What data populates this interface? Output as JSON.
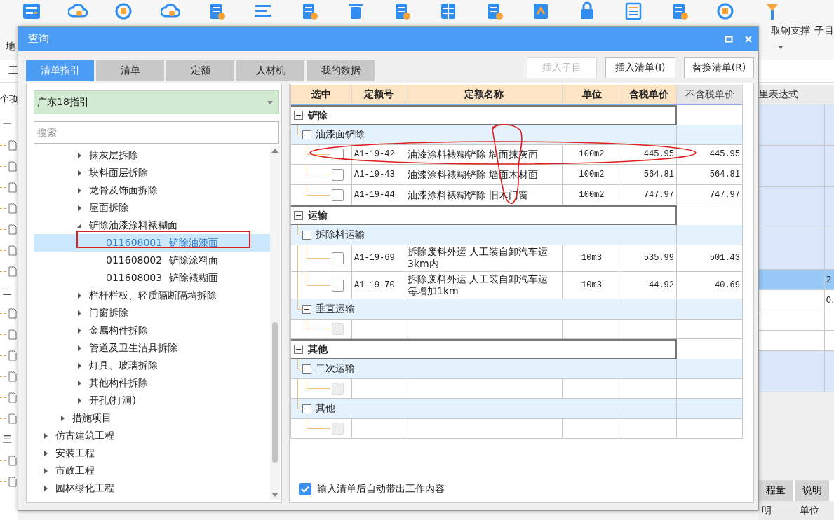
{
  "app": {
    "toolbar": {
      "left_label": "地",
      "right_labels": [
        "取钢支撑",
        "子目"
      ]
    },
    "ribbon_label": "工",
    "left_panel": {
      "header": "个项",
      "items": [
        {
          "kind": "node",
          "label": "一"
        },
        {
          "kind": "doc"
        },
        {
          "kind": "doc"
        },
        {
          "kind": "doc"
        },
        {
          "kind": "doc"
        },
        {
          "kind": "doc"
        },
        {
          "kind": "doc"
        },
        {
          "kind": "doc"
        },
        {
          "kind": "node",
          "label": "二"
        },
        {
          "kind": "doc"
        },
        {
          "kind": "doc"
        },
        {
          "kind": "doc"
        },
        {
          "kind": "doc"
        },
        {
          "kind": "doc"
        },
        {
          "kind": "doc"
        },
        {
          "kind": "node",
          "label": "三"
        },
        {
          "kind": "doc"
        },
        {
          "kind": "doc"
        }
      ]
    },
    "right_panel": {
      "header": "里表达式",
      "rows": [
        {
          "kind": "blue"
        },
        {
          "kind": "blue"
        },
        {
          "kind": "blue"
        },
        {
          "kind": "blue"
        },
        {
          "kind": "blue",
          "value": "2",
          "selected": true
        },
        {
          "kind": "white",
          "value": "0."
        },
        {
          "kind": "white"
        },
        {
          "kind": "white"
        },
        {
          "kind": "blue"
        }
      ],
      "tabs": [
        {
          "label": "程量",
          "selected": false
        },
        {
          "label": "说明",
          "selected": false
        }
      ],
      "columns": [
        "明",
        "单位"
      ]
    }
  },
  "dialog": {
    "title": "查询",
    "tabs": [
      {
        "label": "清单指引",
        "selected": true
      },
      {
        "label": "清单",
        "selected": false
      },
      {
        "label": "定额",
        "selected": false
      },
      {
        "label": "人材机",
        "selected": false
      },
      {
        "label": "我的数据",
        "selected": false
      }
    ],
    "buttons": [
      {
        "label": "插入子目",
        "disabled": true
      },
      {
        "label": "插入清单(I)",
        "disabled": false
      },
      {
        "label": "替换清单(R)",
        "disabled": false
      }
    ],
    "library": "广东18指引",
    "search": {
      "placeholder": "搜索"
    },
    "tree": [
      {
        "children": [
          {
            "children": [
              {
                "label": "抹灰层拆除",
                "expanded": false,
                "selected": false
              },
              {
                "label": "块料面层拆除",
                "expanded": false,
                "selected": false
              },
              {
                "label": "龙骨及饰面拆除",
                "expanded": false,
                "selected": false
              },
              {
                "label": "屋面拆除",
                "expanded": false,
                "selected": false
              },
              {
                "label": "铲除油漆涂料裱糊面",
                "expanded": true,
                "selected": false,
                "children": [
                  {
                    "code": "011608001",
                    "name": "铲除油漆面",
                    "selected": true
                  },
                  {
                    "code": "011608002",
                    "name": "铲除涂料面",
                    "selected": false
                  },
                  {
                    "code": "011608003",
                    "name": "铲除裱糊面",
                    "selected": false
                  }
                ]
              },
              {
                "label": "栏杆栏板、轻质隔断隔墙拆除",
                "expanded": false,
                "selected": false
              },
              {
                "label": "门窗拆除",
                "expanded": false,
                "selected": false
              },
              {
                "label": "金属构件拆除",
                "expanded": false,
                "selected": false
              },
              {
                "label": "管道及卫生洁具拆除",
                "expanded": false,
                "selected": false
              },
              {
                "label": "灯具、玻璃拆除",
                "expanded": false,
                "selected": false
              },
              {
                "label": "其他构件拆除",
                "expanded": false,
                "selected": false
              },
              {
                "label": "开孔(打洞)",
                "expanded": false,
                "selected": false
              }
            ]
          },
          {
            "label": "措施项目",
            "expanded": false,
            "selected": false
          }
        ]
      },
      {
        "label": "仿古建筑工程",
        "expanded": false,
        "selected": false
      },
      {
        "label": "安装工程",
        "expanded": false,
        "selected": false
      },
      {
        "label": "市政工程",
        "expanded": false,
        "selected": false
      },
      {
        "label": "园林绿化工程",
        "expanded": false,
        "selected": false
      }
    ],
    "table": {
      "columns": [
        {
          "label": "选中",
          "highlighted": true
        },
        {
          "label": "定额号",
          "highlighted": true
        },
        {
          "label": "定额名称",
          "highlighted": true
        },
        {
          "label": "单位",
          "highlighted": true
        },
        {
          "label": "含税单价",
          "highlighted": true
        },
        {
          "label": "不含税单价",
          "highlighted": false
        }
      ],
      "groups": [
        {
          "label": "铲除",
          "expanded": true,
          "children": [
            {
              "label": "油漆面铲除",
              "expanded": true,
              "rows": [
                {
                  "code": "A1-19-42",
                  "name": "油漆涂料裱糊铲除 墙面抹灰面",
                  "unit": "100m2",
                  "price_tax": "445.95",
                  "price": "445.95",
                  "checked": false,
                  "disabled": false
                },
                {
                  "code": "A1-19-43",
                  "name": "油漆涂料裱糊铲除 墙面木材面",
                  "unit": "100m2",
                  "price_tax": "564.81",
                  "price": "564.81",
                  "checked": false,
                  "disabled": false
                },
                {
                  "code": "A1-19-44",
                  "name": "油漆涂料裱糊铲除 旧木门窗",
                  "unit": "100m2",
                  "price_tax": "747.97",
                  "price": "747.97",
                  "checked": false,
                  "disabled": false
                }
              ]
            }
          ]
        },
        {
          "label": "运输",
          "expanded": true,
          "children": [
            {
              "label": "拆除料运输",
              "expanded": true,
              "rows": [
                {
                  "code": "A1-19-69",
                  "name": "拆除废料外运 人工装自卸汽车运3km内",
                  "unit": "10m3",
                  "price_tax": "535.99",
                  "price": "501.43",
                  "checked": false,
                  "disabled": false
                },
                {
                  "code": "A1-19-70",
                  "name": "拆除废料外运 人工装自卸汽车运每增加1km",
                  "unit": "10m3",
                  "price_tax": "44.92",
                  "price": "40.69",
                  "checked": false,
                  "disabled": false
                }
              ]
            },
            {
              "label": "垂直运输",
              "expanded": true,
              "rows": [
                {
                  "checked": false,
                  "disabled": true
                }
              ]
            }
          ]
        },
        {
          "label": "其他",
          "expanded": true,
          "children": [
            {
              "label": "二次运输",
              "expanded": true,
              "rows": [
                {
                  "checked": false,
                  "disabled": true
                }
              ]
            },
            {
              "label": "其他",
              "expanded": true,
              "rows": [
                {
                  "checked": false,
                  "disabled": true
                }
              ]
            }
          ]
        }
      ]
    },
    "auto_fill": {
      "label": "输入清单后自动带出工作内容",
      "checked": true
    }
  }
}
